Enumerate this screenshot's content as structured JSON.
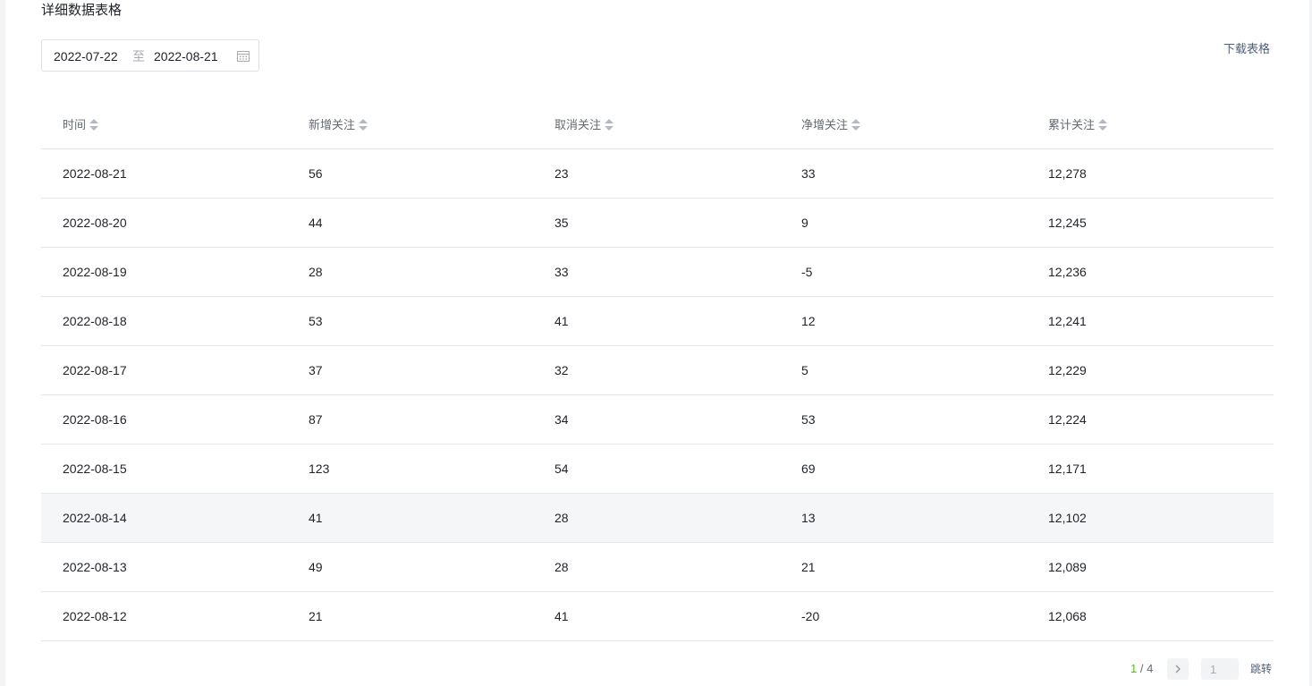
{
  "section": {
    "title": "详细数据表格"
  },
  "date_range": {
    "start": "2022-07-22",
    "separator": "至",
    "end": "2022-08-21"
  },
  "download": {
    "label": "下载表格"
  },
  "table": {
    "columns": [
      "时间",
      "新增关注",
      "取消关注",
      "净增关注",
      "累计关注"
    ],
    "rows": [
      [
        "2022-08-21",
        "56",
        "23",
        "33",
        "12,278"
      ],
      [
        "2022-08-20",
        "44",
        "35",
        "9",
        "12,245"
      ],
      [
        "2022-08-19",
        "28",
        "33",
        "-5",
        "12,236"
      ],
      [
        "2022-08-18",
        "53",
        "41",
        "12",
        "12,241"
      ],
      [
        "2022-08-17",
        "37",
        "32",
        "5",
        "12,229"
      ],
      [
        "2022-08-16",
        "87",
        "34",
        "53",
        "12,224"
      ],
      [
        "2022-08-15",
        "123",
        "54",
        "69",
        "12,171"
      ],
      [
        "2022-08-14",
        "41",
        "28",
        "13",
        "12,102"
      ],
      [
        "2022-08-13",
        "49",
        "28",
        "21",
        "12,089"
      ],
      [
        "2022-08-12",
        "21",
        "41",
        "-20",
        "12,068"
      ]
    ],
    "highlighted_row_index": 7
  },
  "pagination": {
    "current": "1",
    "separator": " / ",
    "total": "4",
    "input_value": "1",
    "jump_label": "跳转"
  },
  "colors": {
    "accent_green": "#52c41a",
    "link": "#51607a",
    "row_hover": "#f5f6f7"
  },
  "icons": {
    "calendar": "calendar-icon",
    "sort": "sort-icon",
    "next": "chevron-right-icon"
  }
}
